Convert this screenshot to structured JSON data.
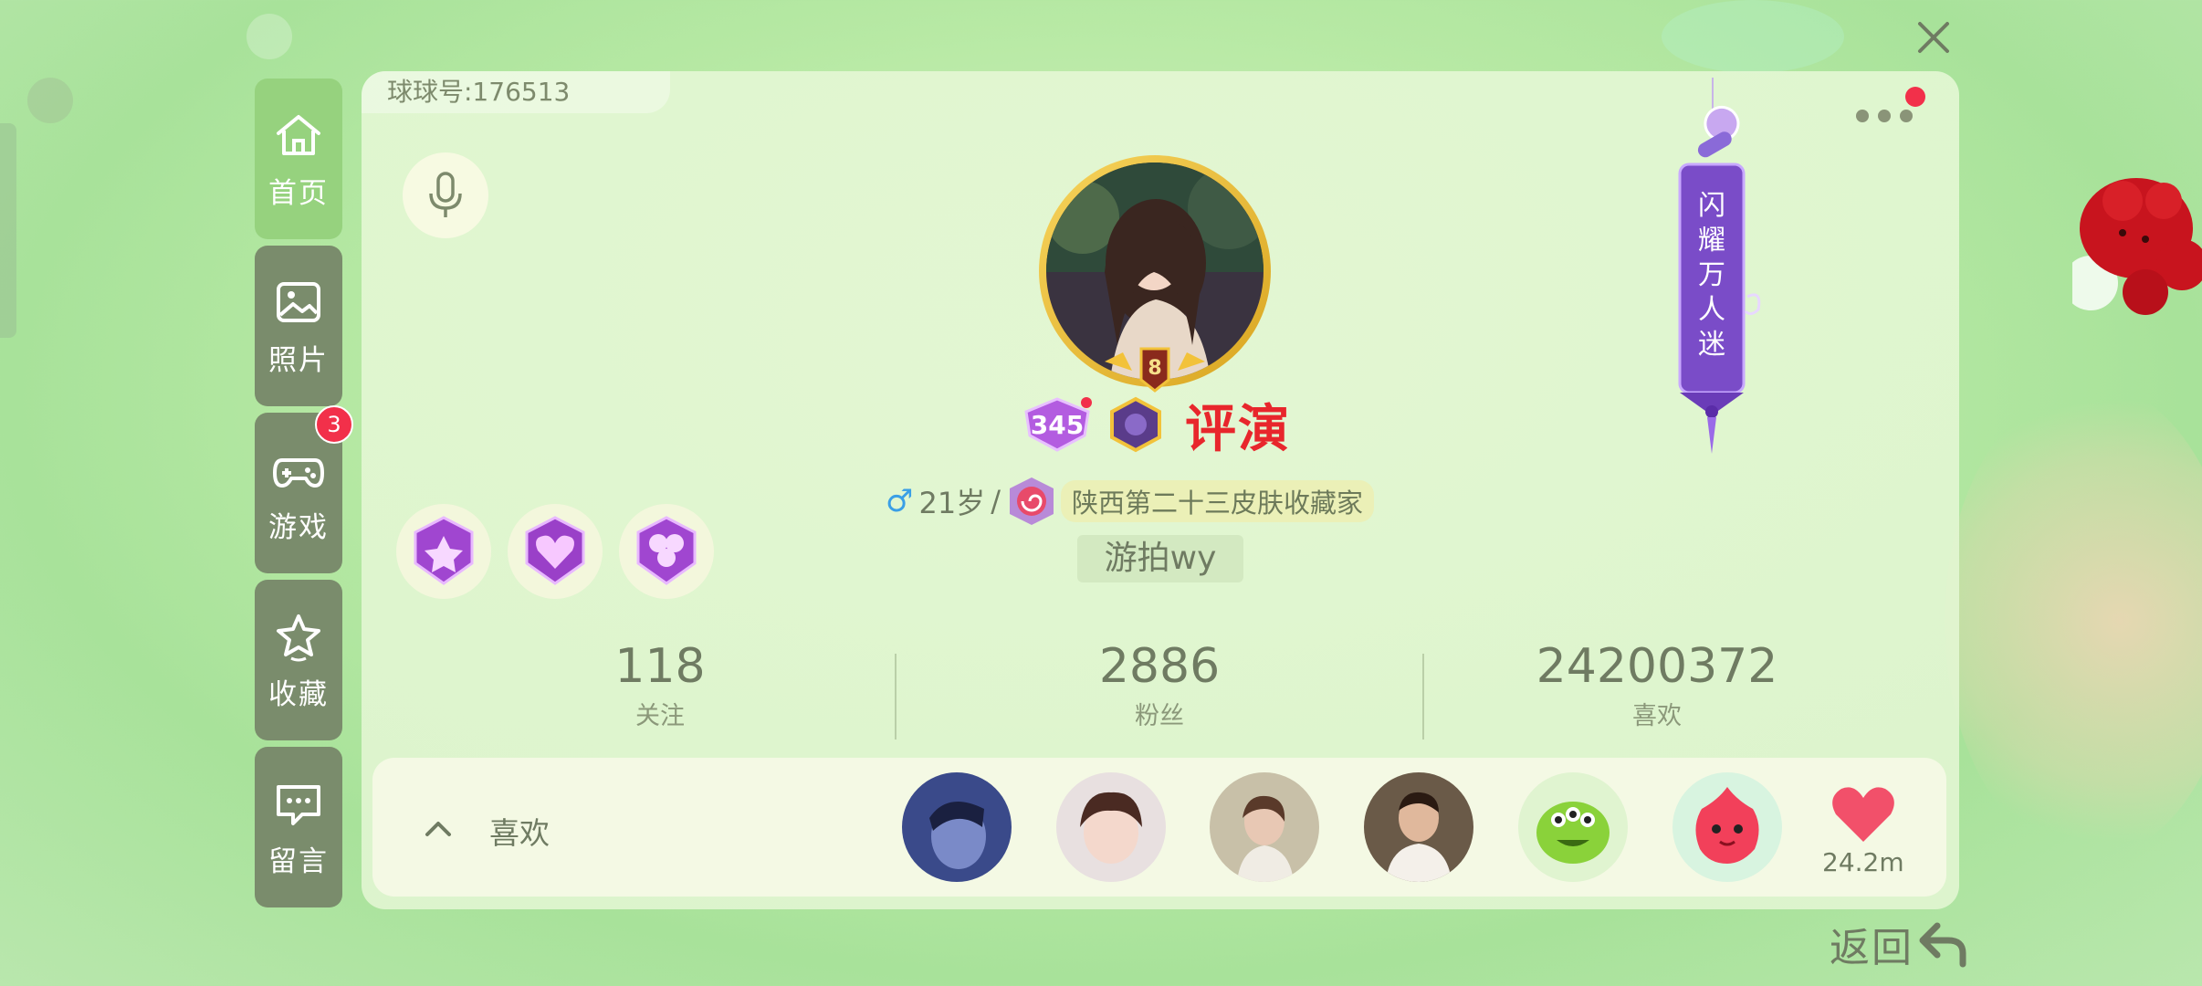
{
  "sidebar": {
    "items": [
      {
        "label": "首页",
        "icon": "home-icon",
        "active": true
      },
      {
        "label": "照片",
        "icon": "photo-icon"
      },
      {
        "label": "游戏",
        "icon": "gamepad-icon",
        "badge": "3"
      },
      {
        "label": "收藏",
        "icon": "star-icon"
      },
      {
        "label": "留言",
        "icon": "message-icon"
      }
    ]
  },
  "profile": {
    "id_label": "球球号:176513",
    "level_badge": "8",
    "rank_number": "345",
    "name": "评演",
    "gender_symbol": "♂",
    "age": "21岁",
    "separator": "/",
    "title_tag": "陕西第二十三皮肤收藏家",
    "nickname": "游拍wy",
    "banner_title": "闪耀万人迷"
  },
  "stats": [
    {
      "value": "118",
      "label": "关注"
    },
    {
      "value": "2886",
      "label": "粉丝"
    },
    {
      "value": "24200372",
      "label": "喜欢"
    }
  ],
  "likes": {
    "label": "喜欢",
    "count": "24.2m"
  },
  "footer": {
    "back_label": "返回"
  },
  "colors": {
    "accent_green": "#96d27e",
    "name_red": "#e8262c",
    "badge_red": "#f2304a",
    "text_gray": "#6f7b62"
  }
}
